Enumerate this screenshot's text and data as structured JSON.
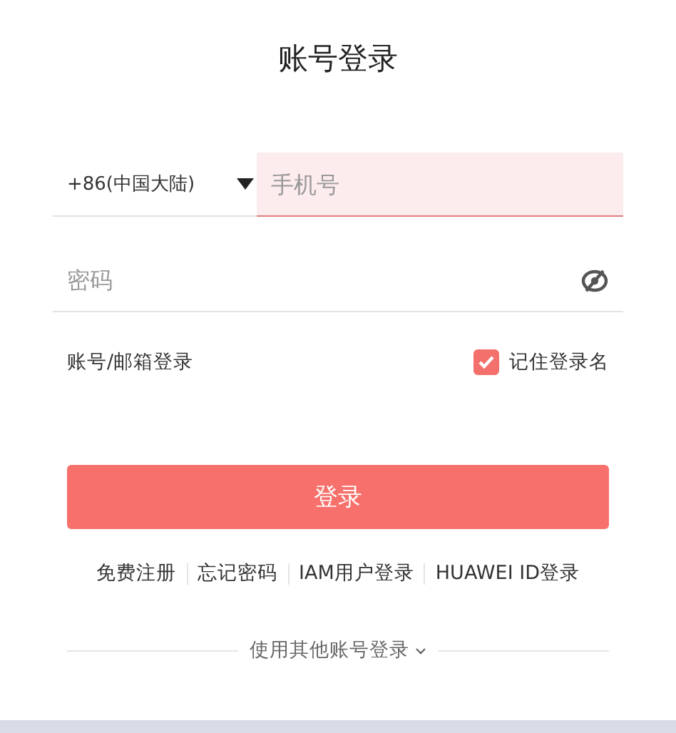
{
  "title": "账号登录",
  "phone": {
    "country_code": "+86(中国大陆)",
    "placeholder": "手机号",
    "focused": true
  },
  "password": {
    "placeholder": "密码"
  },
  "alt_login": "账号/邮箱登录",
  "remember": {
    "label": "记住登录名",
    "checked": true
  },
  "submit": "登录",
  "links": [
    "免费注册",
    "忘记密码",
    "IAM用户登录",
    "HUAWEI ID登录"
  ],
  "other_login": "使用其他账号登录"
}
